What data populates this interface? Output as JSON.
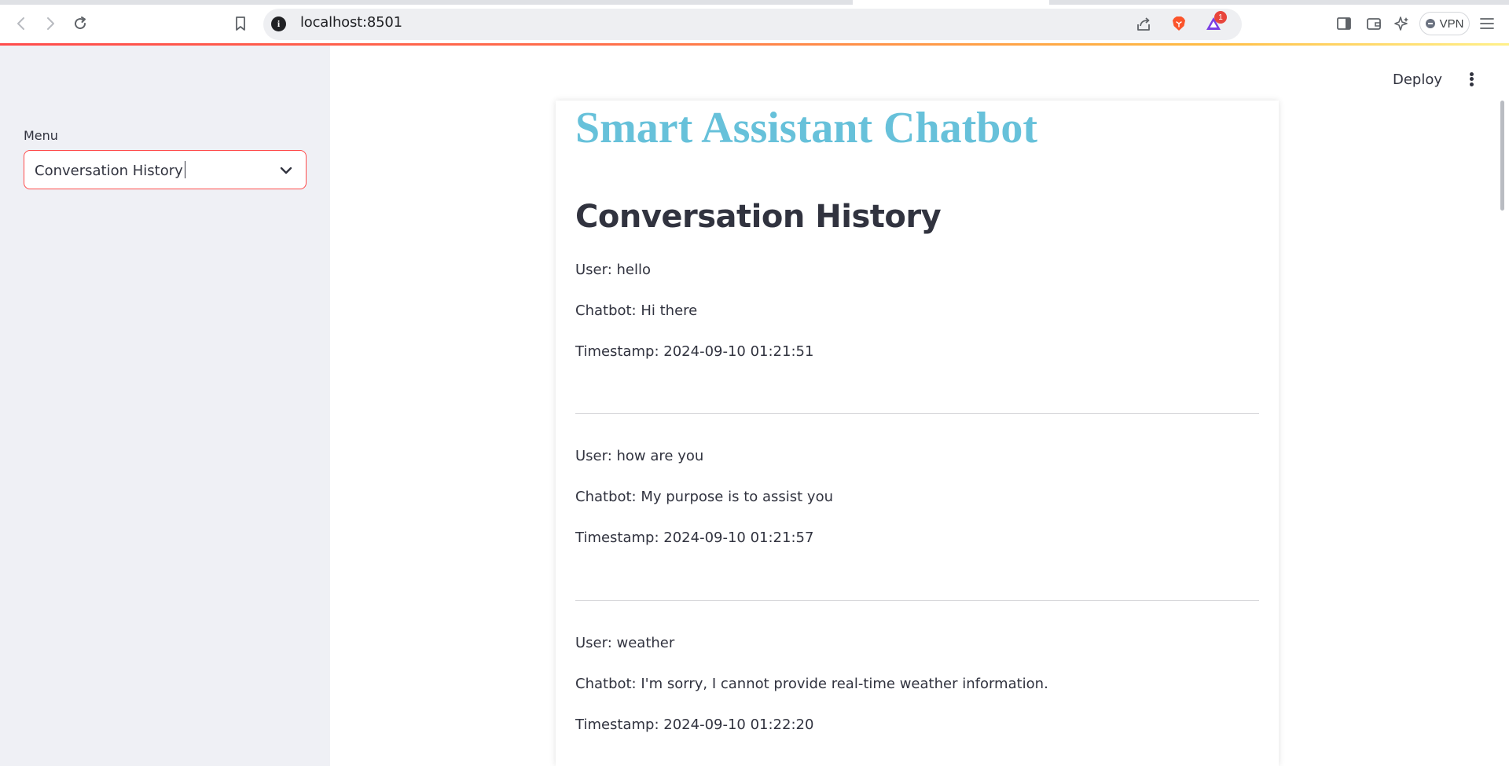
{
  "browser": {
    "url": "localhost:8501",
    "site_info_glyph": "i",
    "alert_badge_count": "1",
    "vpn_label": "VPN"
  },
  "sidebar": {
    "menu_label": "Menu",
    "selected_option": "Conversation History"
  },
  "header": {
    "deploy_label": "Deploy"
  },
  "main": {
    "app_title": "Smart Assistant Chatbot",
    "section_title": "Conversation History",
    "entries": [
      {
        "user": "User: hello",
        "bot": "Chatbot: Hi there",
        "timestamp": "Timestamp: 2024-09-10 01:21:51"
      },
      {
        "user": "User: how are you",
        "bot": "Chatbot: My purpose is to assist you",
        "timestamp": "Timestamp: 2024-09-10 01:21:57"
      },
      {
        "user": "User: weather",
        "bot": "Chatbot: I'm sorry, I cannot provide real-time weather information.",
        "timestamp": "Timestamp: 2024-09-10 01:22:20"
      }
    ]
  },
  "colors": {
    "title": "#67c1da",
    "accent": "#ff4b4b",
    "sidebar_bg": "#eff0f5",
    "text": "#31333f"
  }
}
